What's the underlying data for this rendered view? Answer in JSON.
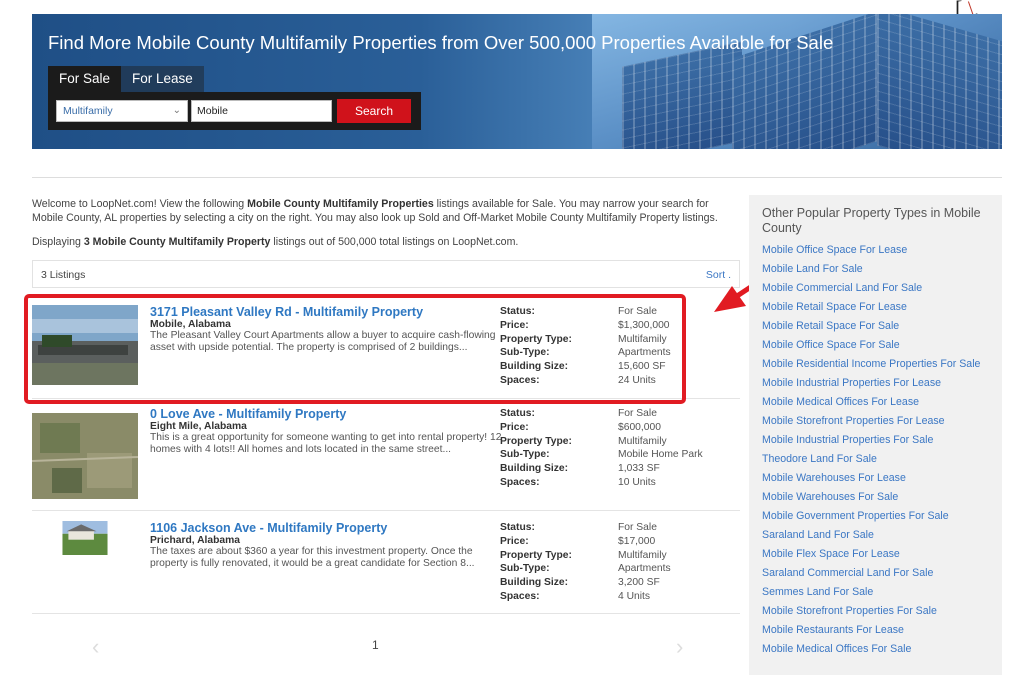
{
  "hero": {
    "title": "Find More Mobile County Multifamily Properties from Over 500,000 Properties Available for Sale",
    "tabs": [
      {
        "label": "For Sale",
        "active": true
      },
      {
        "label": "For Lease",
        "active": false
      }
    ],
    "property_type": "Multifamily",
    "location_value": "Mobile",
    "search_label": "Search"
  },
  "intro": {
    "p1_a": "Welcome to LoopNet.com! View the following ",
    "p1_b": "Mobile County Multifamily Properties",
    "p1_c": " listings available for Sale. You may narrow your search for Mobile County, AL properties by selecting a city on the right. You may also look up Sold and Off-Market Mobile County Multifamily Property listings.",
    "display_a": "Displaying ",
    "display_b": "3 Mobile County Multifamily Property",
    "display_c": " listings out of 500,000 total listings on LoopNet.com."
  },
  "listbar": {
    "count": "3 Listings",
    "sort": "Sort ."
  },
  "field_labels": [
    "Status:",
    "Price:",
    "Property Type:",
    "Sub-Type:",
    "Building Size:",
    "Spaces:"
  ],
  "listings": [
    {
      "title": "3171 Pleasant Valley Rd - Multifamily Property",
      "city": "Mobile, Alabama",
      "desc": "The Pleasant Valley Court Apartments allow a buyer to acquire cash-flowing asset with upside potential. The property is comprised of 2 buildings...",
      "values": [
        "For Sale",
        "$1,300,000",
        "Multifamily",
        "Apartments",
        "15,600 SF",
        "24 Units"
      ]
    },
    {
      "title": "0 Love Ave - Multifamily Property",
      "city": "Eight Mile, Alabama",
      "desc": "This is a great opportunity for someone wanting to get into rental property! 12 homes with 4 lots!! All homes and lots located in the same street...",
      "values": [
        "For Sale",
        "$600,000",
        "Multifamily",
        "Mobile Home Park",
        "1,033 SF",
        "10 Units"
      ]
    },
    {
      "title": "1106 Jackson Ave - Multifamily Property",
      "city": "Prichard, Alabama",
      "desc": "The taxes are about $360 a year for this investment property. Once the property is fully renovated, it would be a great candidate for Section 8...",
      "values": [
        "For Sale",
        "$17,000",
        "Multifamily",
        "Apartments",
        "3,200 SF",
        "4 Units"
      ]
    }
  ],
  "pager": {
    "current": "1",
    "prev_icon": "chevron-left-icon",
    "next_icon": "chevron-right-icon"
  },
  "sidebar": {
    "title": "Other Popular Property Types in Mobile County",
    "links": [
      "Mobile Office Space For Lease",
      "Mobile Land For Sale",
      "Mobile Commercial Land For Sale",
      "Mobile Retail Space For Lease",
      "Mobile Retail Space For Sale",
      "Mobile Office Space For Sale",
      "Mobile Residential Income Properties For Sale",
      "Mobile Industrial Properties For Lease",
      "Mobile Medical Offices For Lease",
      "Mobile Storefront Properties For Lease",
      "Mobile Industrial Properties For Sale",
      "Theodore Land For Sale",
      "Mobile Warehouses For Lease",
      "Mobile Warehouses For Sale",
      "Mobile Government Properties For Sale",
      "Saraland Land For Sale",
      "Mobile Flex Space For Lease",
      "Saraland Commercial Land For Sale",
      "Semmes Land For Sale",
      "Mobile Storefront Properties For Sale",
      "Mobile Restaurants For Lease",
      "Mobile Medical Offices For Sale"
    ]
  },
  "annotation": {
    "highlight_color": "#e11b22",
    "arrow_color": "#e11b22"
  },
  "corner_mark": {
    "open": "[",
    "slash": "\\",
    "tail": ","
  }
}
